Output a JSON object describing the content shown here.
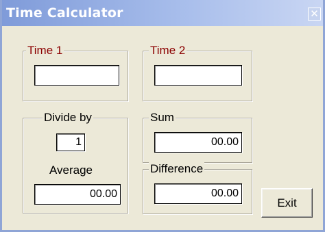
{
  "window": {
    "title": "Time Calculator",
    "close_symbol": "✕"
  },
  "time1": {
    "label": "Time 1",
    "value": ""
  },
  "time2": {
    "label": "Time 2",
    "value": ""
  },
  "divide": {
    "label": "Divide by",
    "value": "1"
  },
  "average": {
    "label": "Average",
    "value": "00.00"
  },
  "sum": {
    "label": "Sum",
    "value": "00.00"
  },
  "difference": {
    "label": "Difference",
    "value": "00.00"
  },
  "exit_label": "Exit",
  "colors": {
    "titlebar_start": "#7f9bd9",
    "window_face": "#ece9d8",
    "group_label_red": "#8b0000"
  },
  "icons": {
    "close": "close-icon"
  }
}
